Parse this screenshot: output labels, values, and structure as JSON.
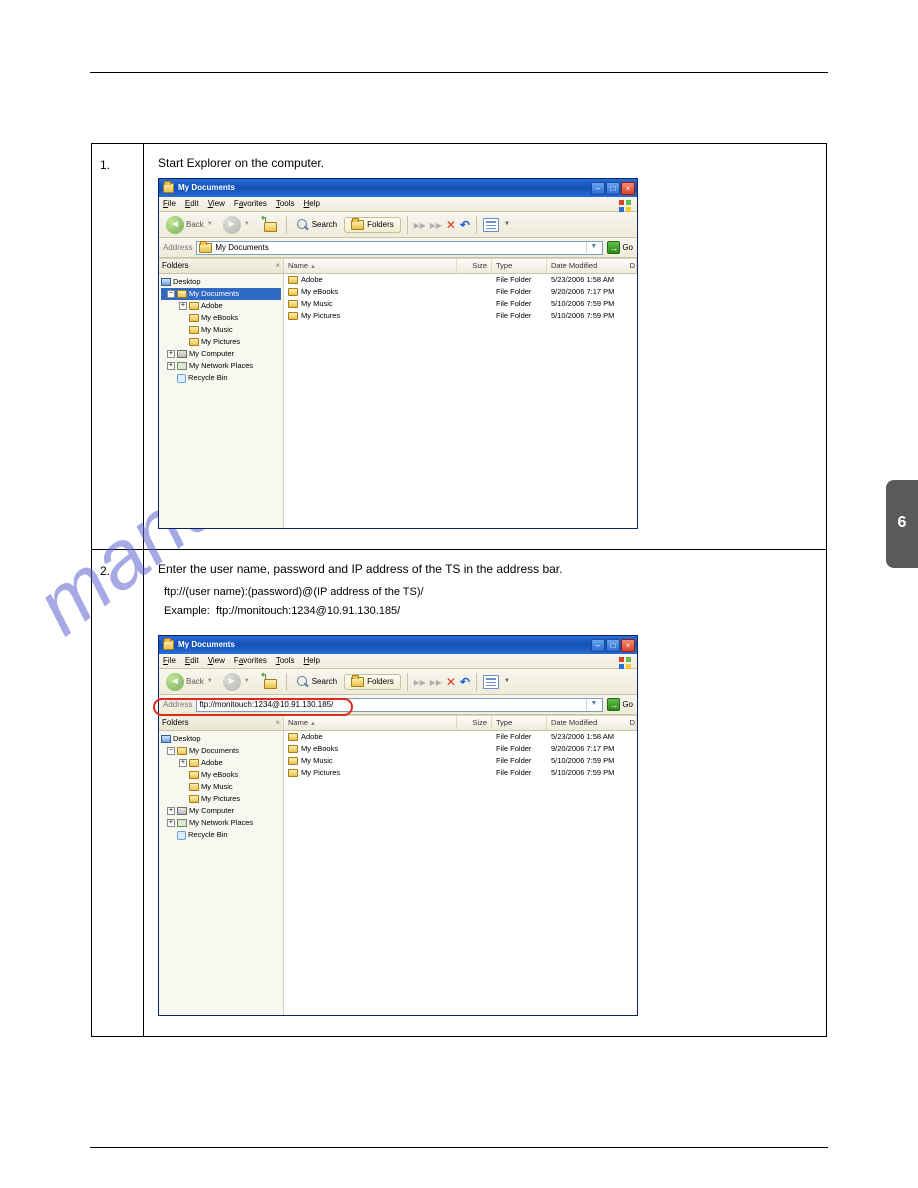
{
  "section_tab": "6",
  "row1": {
    "num": "1.",
    "caption": "Start Explorer on the computer."
  },
  "row2": {
    "num": "2.",
    "caption": "Enter the user name, password and IP address of the TS in the address bar.",
    "ftp_format_label": "ftp://(user name):(password)@(IP address of the TS)/",
    "example_label": "Example:",
    "example_value": "ftp://monitouch:1234@10.91.130.185/"
  },
  "xp": {
    "title": "My Documents",
    "menus": [
      "File",
      "Edit",
      "View",
      "Favorites",
      "Tools",
      "Help"
    ],
    "underline_idx": [
      0,
      0,
      0,
      0,
      0,
      0
    ],
    "toolbar": {
      "back": "Back",
      "search": "Search",
      "folders": "Folders"
    },
    "address_label": "Address",
    "address_value_1": "My Documents",
    "address_value_2": "ftp://monitouch:1234@10.91.130.185/",
    "go": "Go",
    "folders_header": "Folders",
    "tree": {
      "desktop": "Desktop",
      "mydocs": "My Documents",
      "adobe": "Adobe",
      "ebooks": "My eBooks",
      "music": "My Music",
      "pictures": "My Pictures",
      "computer": "My Computer",
      "network": "My Network Places",
      "recycle": "Recycle Bin"
    },
    "columns": {
      "name": "Name",
      "size": "Size",
      "type": "Type",
      "date": "Date Modified",
      "corner": "D"
    },
    "rows": [
      {
        "name": "Adobe",
        "type": "File Folder",
        "date": "5/23/2006 1:58 AM"
      },
      {
        "name": "My eBooks",
        "type": "File Folder",
        "date": "9/20/2006 7:17 PM"
      },
      {
        "name": "My Music",
        "type": "File Folder",
        "date": "5/10/2006 7:59 PM"
      },
      {
        "name": "My Pictures",
        "type": "File Folder",
        "date": "5/10/2006 7:59 PM"
      }
    ]
  }
}
